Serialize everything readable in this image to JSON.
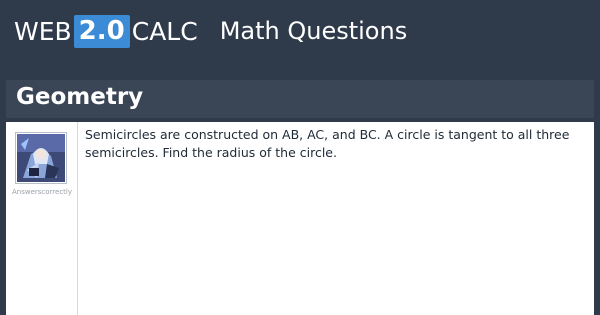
{
  "header": {
    "logo_prefix": "WEB",
    "logo_badge": "2.0",
    "logo_suffix": "CALC",
    "tagline": "Math Questions"
  },
  "section": {
    "title": "Geometry"
  },
  "post": {
    "username": "Answerscorrectly",
    "text": "Semicircles are constructed on AB, AC, and BC. A circle is tangent to all three semicircles. Find the radius of the circle."
  },
  "colors": {
    "background": "#2f3a4a",
    "header_bar": "#3a4556",
    "badge": "#3b8bd6",
    "panel": "#ffffff"
  }
}
